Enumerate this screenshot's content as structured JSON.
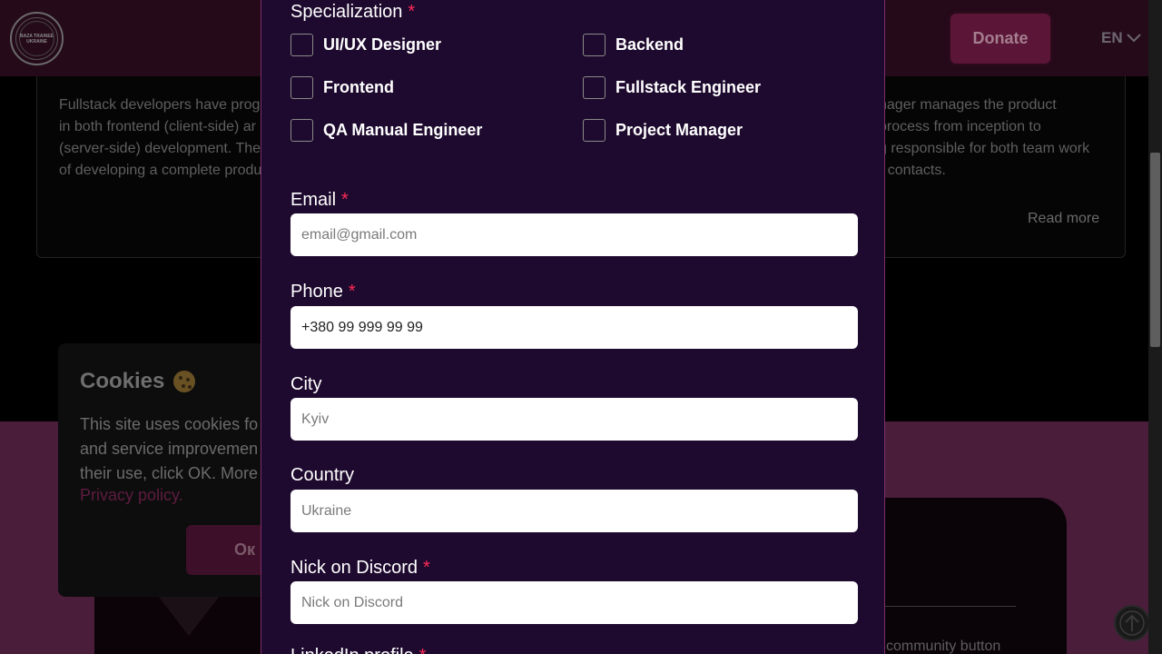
{
  "header": {
    "logo_text": "BAZA TRAINEE UKRAINE",
    "donate_label": "Donate",
    "language": "EN"
  },
  "background": {
    "left_card_lines": [
      "Fullstack developers have prog",
      "in both frontend (client-side) ar",
      "(server-side) development. The",
      "of developing a complete produ"
    ],
    "right_card_lines": [
      "nager manages the product",
      "process from inception to",
      "g responsible for both team work",
      "r contacts."
    ],
    "read_more": "Read more",
    "lower_text": "community button"
  },
  "cookies": {
    "title": "Cookies",
    "lines": [
      "This site uses cookies fo",
      "and service improvemen",
      "their use, click OK. More"
    ],
    "privacy_link": "Privacy policy.",
    "ok_label": "Ок"
  },
  "form": {
    "specialization": {
      "label": "Specialization",
      "required": "*",
      "options": [
        "UI/UX Designer",
        "Backend",
        "Frontend",
        "Fullstack Engineer",
        "QA Manual Engineer",
        "Project Manager"
      ]
    },
    "email": {
      "label": "Email",
      "required": "*",
      "placeholder": "email@gmail.com"
    },
    "phone": {
      "label": "Phone",
      "required": "*",
      "value": "+380 99 999 99 99"
    },
    "city": {
      "label": "City",
      "placeholder": "Kyiv"
    },
    "country": {
      "label": "Country",
      "placeholder": "Ukraine"
    },
    "discord": {
      "label": "Nick on Discord",
      "required": "*",
      "placeholder": "Nick on Discord"
    },
    "next_label_partial": "LinkedIn profile"
  },
  "colors": {
    "modal_bg": "#1e0a2e",
    "accent_border": "#7d2d6a",
    "required_mark": "#ff2a58",
    "donate_bg": "#5a1537"
  },
  "icons": {
    "language_dropdown": "chevron-down-icon",
    "scroll_top": "arrow-up-icon",
    "cookie": "cookie-icon"
  }
}
